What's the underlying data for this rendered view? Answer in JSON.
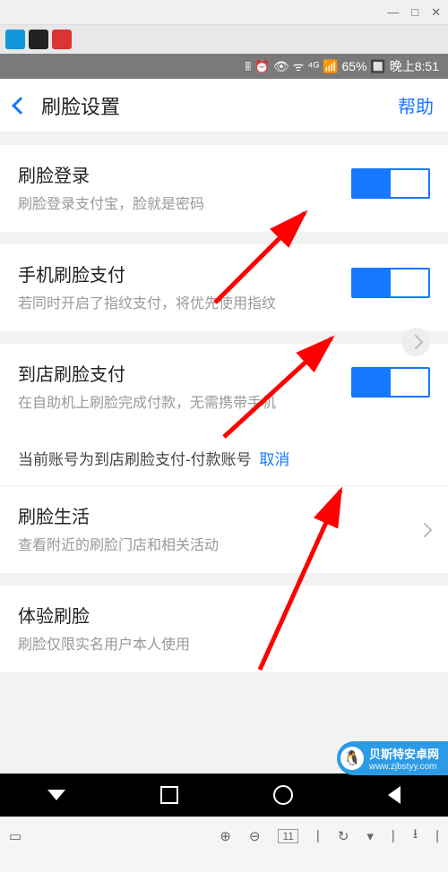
{
  "window": {
    "minimize": "—",
    "maximize": "□",
    "close": "✕"
  },
  "statusbar": {
    "right": "𝄝 ⏰ 👁 ᯤ ⁴ᴳ 📶 65% 🔲 晚上8:51"
  },
  "appbar": {
    "title": "刷脸设置",
    "help": "帮助"
  },
  "items": {
    "login": {
      "title": "刷脸登录",
      "sub": "刷脸登录支付宝，脸就是密码"
    },
    "phonepay": {
      "title": "手机刷脸支付",
      "sub": "若同时开启了指纹支付，将优先使用指纹"
    },
    "storepay": {
      "title": "到店刷脸支付",
      "sub": "在自助机上刷脸完成付款，无需携带手机"
    },
    "accountLine": {
      "text": "当前账号为到店刷脸支付-付款账号",
      "cancel": "取消"
    },
    "life": {
      "title": "刷脸生活",
      "sub": "查看附近的刷脸门店和相关活动"
    },
    "try": {
      "title": "体验刷脸",
      "sub": "刷脸仅限实名用户本人使用"
    }
  },
  "toolbar": {
    "zoom": "11"
  },
  "watermark": {
    "brand": "贝斯特安卓网",
    "url": "www.zjbstyy.com"
  }
}
